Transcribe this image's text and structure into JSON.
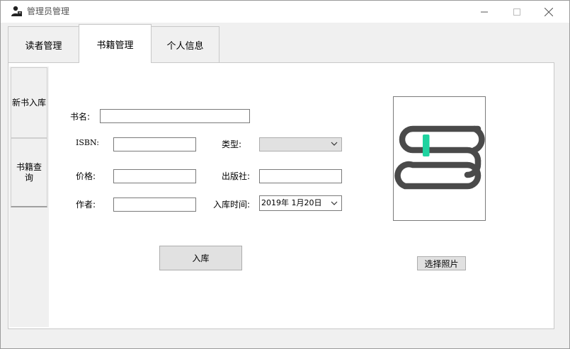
{
  "window": {
    "title": "管理员管理",
    "icon": "user-admin-icon",
    "controls": {
      "minimize": "minimize-icon",
      "maximize": "maximize-icon",
      "close": "close-icon"
    }
  },
  "tabs": [
    {
      "label": "读者管理",
      "active": false
    },
    {
      "label": "书籍管理",
      "active": true
    },
    {
      "label": "个人信息",
      "active": false
    }
  ],
  "side_tabs": [
    {
      "label": "新书入库",
      "active": true
    },
    {
      "label": "书籍查询",
      "active": false
    }
  ],
  "form": {
    "title_label": "书名:",
    "title_value": "",
    "isbn_label": "ISBN:",
    "isbn_value": "",
    "type_label": "类型:",
    "type_value": "",
    "price_label": "价格:",
    "price_value": "",
    "publisher_label": "出版社:",
    "publisher_value": "",
    "author_label": "作者:",
    "author_value": "",
    "date_label": "入库时间:",
    "date_value": "2019年  1月20日",
    "submit_label": "入库"
  },
  "photo": {
    "image": "book-placeholder-icon",
    "accent_color": "#1fd3a0",
    "stroke_color": "#4a4a4a",
    "choose_label": "选择照片"
  }
}
